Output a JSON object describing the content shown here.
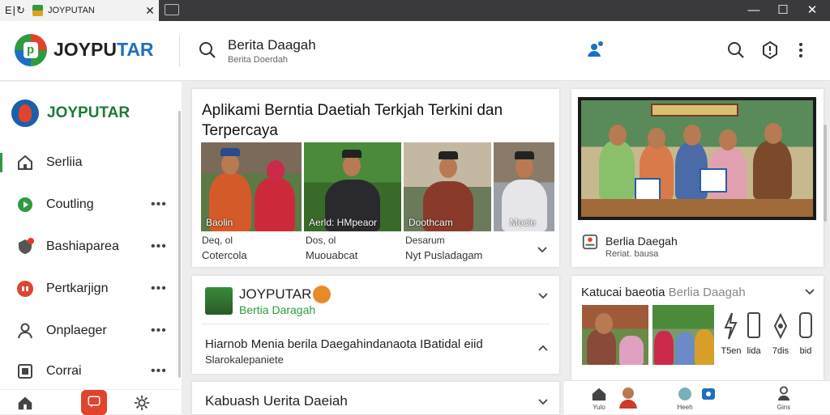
{
  "browser": {
    "nav_glyphs": "E|↻",
    "tab_title": "JOYPUTAN",
    "close_glyph": "✕",
    "window": {
      "minimize": "—",
      "maximize": "☐",
      "close": "✕"
    }
  },
  "header": {
    "brand_main": "JOYPU",
    "brand_accent": "TAR",
    "title": "Berita Daagah",
    "subtitle": "Berita Doerdah",
    "accent_color": "#1d6fc1"
  },
  "sidebar": {
    "brand": "JOYPUTAR",
    "items": [
      {
        "label": "Serliia",
        "icon": "home-icon",
        "more": ""
      },
      {
        "label": "Coutling",
        "icon": "chat-icon",
        "more": "•••"
      },
      {
        "label": "Bashiaparea",
        "icon": "shield-icon",
        "more": "•••"
      },
      {
        "label": "Pertkarjign",
        "icon": "record-icon",
        "more": "•••"
      },
      {
        "label": "Onplaeger",
        "icon": "user-icon",
        "more": "•••"
      },
      {
        "label": "Corrai",
        "icon": "tv-icon",
        "more": "•••"
      }
    ]
  },
  "hero": {
    "title": "Aplikami Berntia Daetiah Terkjah Terkini dan Terpercaya",
    "photos": [
      {
        "caption": "Baolin"
      },
      {
        "caption": "Aerld: HMpeaor"
      },
      {
        "caption": "Doothcam"
      },
      {
        "caption": "Mocle"
      }
    ],
    "meta": [
      {
        "line1": "Deq, ol",
        "line2": "Cotercola"
      },
      {
        "line1": "Dos, ol",
        "line2": "Muouabcat"
      },
      {
        "line1": "Desarum",
        "line2": "Nyt Pusladagam"
      }
    ]
  },
  "feature": {
    "brand": "JOYPUTAR",
    "subtitle": "Bertia Daragah",
    "headline": "Hiarnob Menia berila Daegahindanaota IBatidal eiid",
    "subline": "Slarokalepaniete"
  },
  "section3": {
    "title": "Kabuash Uerita Daeiah"
  },
  "right_top": {
    "title": "Berlia Daegah",
    "sub": "Reriat. bausa"
  },
  "right_list": {
    "title_bold": "Katucai baeotia",
    "title_light": "Berlia Daagah",
    "icons": [
      {
        "label": "T5en",
        "icon": "lightning-icon"
      },
      {
        "label": "lida",
        "icon": "document-icon"
      },
      {
        "label": "7dis",
        "icon": "diamond-icon"
      },
      {
        "label": "bid",
        "icon": "phone-icon"
      }
    ]
  },
  "bottom_nav": [
    {
      "label": "Yulo",
      "icon": "home-icon"
    },
    {
      "label": "",
      "icon": "avatar-icon"
    },
    {
      "label": "Heeh",
      "icon": "globe-icon"
    },
    {
      "label": "Gins",
      "icon": "profile-icon"
    }
  ]
}
